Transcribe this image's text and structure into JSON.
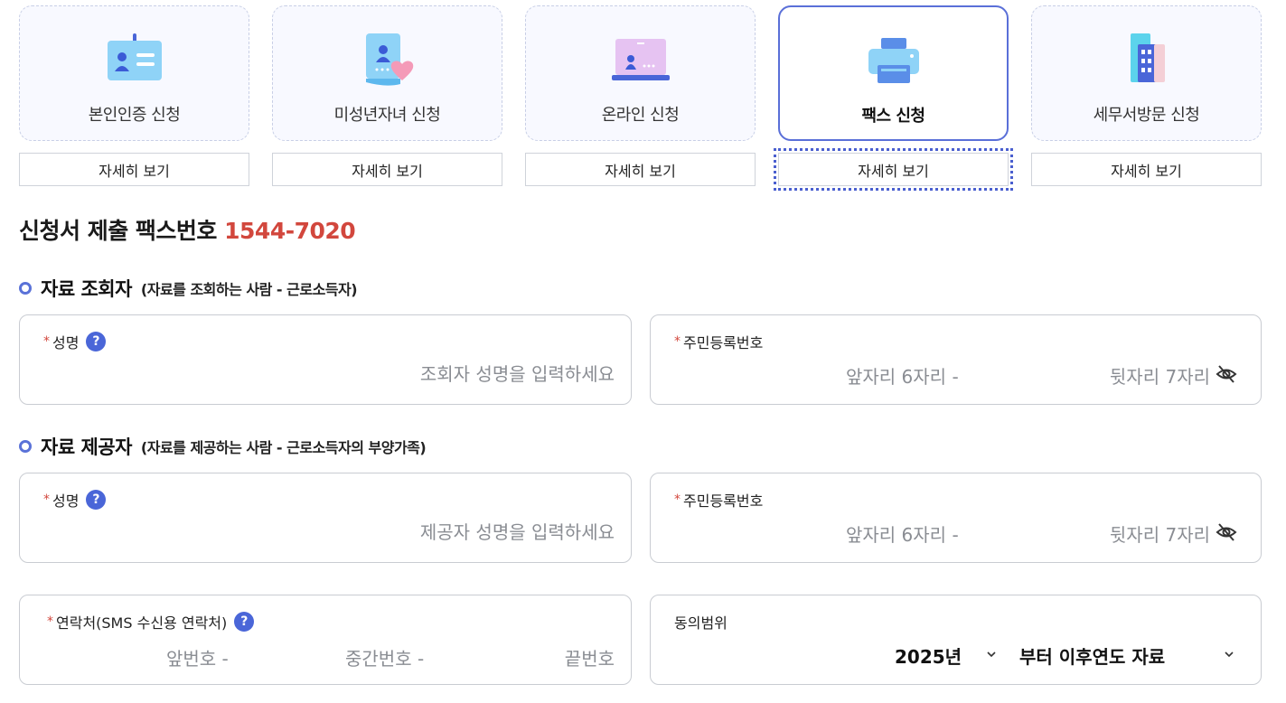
{
  "cards": [
    {
      "label": "본인인증 신청",
      "icon": "id-card-icon",
      "detail": "자세히 보기"
    },
    {
      "label": "미성년자녀 신청",
      "icon": "child-document-icon",
      "detail": "자세히 보기"
    },
    {
      "label": "온라인 신청",
      "icon": "laptop-icon",
      "detail": "자세히 보기"
    },
    {
      "label": "팩스 신청",
      "icon": "fax-printer-icon",
      "detail": "자세히 보기",
      "active": true
    },
    {
      "label": "세무서방문 신청",
      "icon": "building-icon",
      "detail": "자세히 보기"
    }
  ],
  "fax": {
    "title": "신청서 제출 팩스번호",
    "number": "1544-7020"
  },
  "viewer": {
    "title": "자료 조회자",
    "subtitle": "(자료를 조회하는 사람 - 근로소득자)",
    "name_label": "성명",
    "name_placeholder": "조회자 성명을 입력하세요",
    "rrn_label": "주민등록번호",
    "rrn_front": "앞자리 6자리 -",
    "rrn_back": "뒷자리 7자리"
  },
  "provider": {
    "title": "자료 제공자",
    "subtitle": "(자료를 제공하는 사람 - 근로소득자의 부양가족)",
    "name_label": "성명",
    "name_placeholder": "제공자 성명을 입력하세요",
    "rrn_label": "주민등록번호",
    "rrn_front": "앞자리 6자리 -",
    "rrn_back": "뒷자리 7자리"
  },
  "contact": {
    "label": "연락처(SMS 수신용 연락처)",
    "first": "앞번호 -",
    "middle": "중간번호 -",
    "last": "끝번호"
  },
  "consent": {
    "label": "동의범위",
    "year": "2025년",
    "scope": "부터 이후연도 자료"
  },
  "required_mark": "*",
  "help_mark": "?",
  "colors": {
    "accent": "#5a6fd8",
    "fax_number": "#d2473d",
    "help_badge": "#4a66d8"
  }
}
